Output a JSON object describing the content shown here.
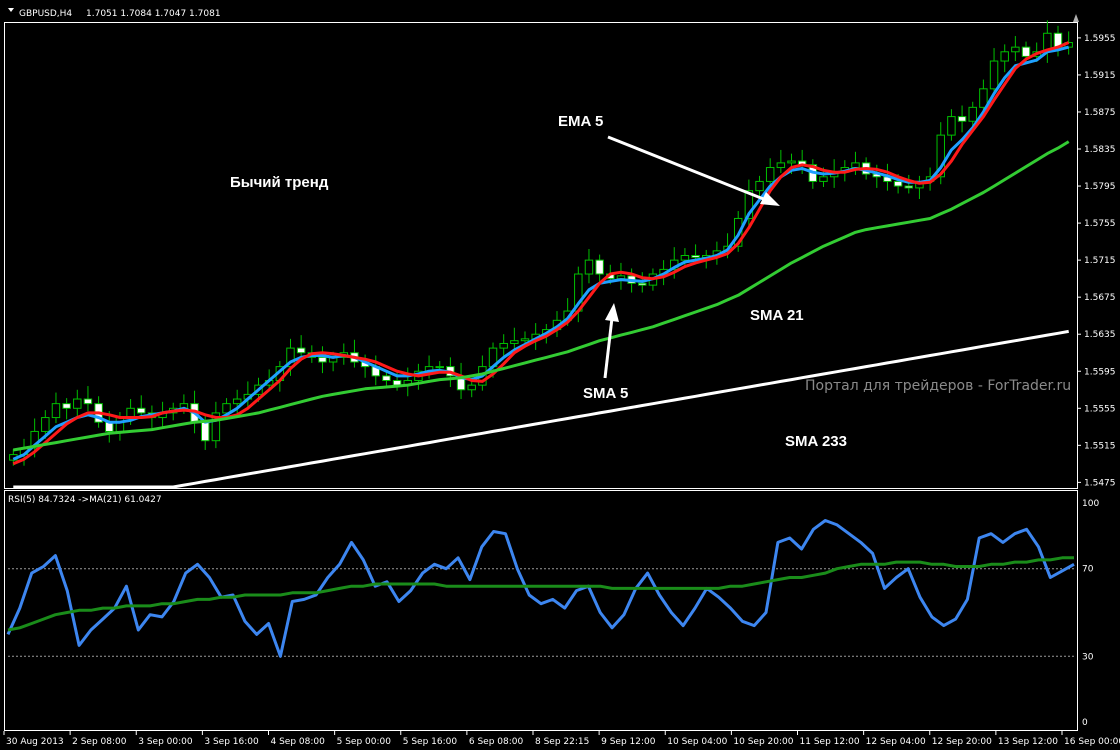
{
  "header": {
    "symbol": "GBPUSD,H4",
    "ohlc": "1.7051 1.7084 1.7047 1.7081"
  },
  "rsi_header": "RSI(5) 84.7324 ->MA(21) 61.0427",
  "annotations": {
    "trend": "Бычий тренд",
    "ema5": "EMA 5",
    "sma5": "SMA 5",
    "sma21": "SMA 21",
    "sma233": "SMA 233",
    "watermark": "Портал для трейдеров - ForTrader.ru"
  },
  "colors": {
    "background": "#000000",
    "frame": "#ffffff",
    "bull_candle": "#00c000",
    "bear_candle_body": "#ffffff",
    "ema5": "#1fa0ff",
    "sma5": "#ff1a1a",
    "sma21": "#33cc33",
    "sma233": "#ffffff",
    "rsi": "#3d86f0",
    "rsi_ma": "#1a8c1a",
    "fractal": "#b0b0b0"
  },
  "chart_data": [
    {
      "type": "candlestick",
      "title": "GBPUSD,H4",
      "price_ticks": [
        "1.5955",
        "1.5915",
        "1.5875",
        "1.5835",
        "1.5795",
        "1.5755",
        "1.5715",
        "1.5675",
        "1.5635",
        "1.5595",
        "1.5555",
        "1.5515",
        "1.5475"
      ],
      "ylim": [
        1.547,
        1.597
      ],
      "time_ticks": [
        "30 Aug 2013",
        "2 Sep 08:00",
        "3 Sep 00:00",
        "3 Sep 16:00",
        "4 Sep 08:00",
        "5 Sep 00:00",
        "5 Sep 16:00",
        "6 Sep 08:00",
        "8 Sep 22:15",
        "9 Sep 12:00",
        "10 Sep 04:00",
        "10 Sep 20:00",
        "11 Sep 12:00",
        "12 Sep 04:00",
        "12 Sep 20:00",
        "13 Sep 12:00",
        "16 Sep 00:00"
      ],
      "closes": [
        1.5505,
        1.5512,
        1.553,
        1.5545,
        1.556,
        1.5555,
        1.5565,
        1.556,
        1.554,
        1.553,
        1.5545,
        1.5555,
        1.555,
        1.5545,
        1.555,
        1.5555,
        1.556,
        1.554,
        1.552,
        1.555,
        1.556,
        1.5565,
        1.557,
        1.558,
        1.5585,
        1.56,
        1.562,
        1.5615,
        1.561,
        1.5605,
        1.561,
        1.5615,
        1.5605,
        1.56,
        1.559,
        1.5585,
        1.558,
        1.5585,
        1.5595,
        1.56,
        1.56,
        1.559,
        1.5575,
        1.558,
        1.56,
        1.562,
        1.5625,
        1.5628,
        1.563,
        1.5635,
        1.564,
        1.565,
        1.566,
        1.57,
        1.5715,
        1.57,
        1.5695,
        1.5698,
        1.569,
        1.5688,
        1.57,
        1.5705,
        1.5715,
        1.572,
        1.5718,
        1.572,
        1.5725,
        1.573,
        1.576,
        1.579,
        1.58,
        1.5815,
        1.582,
        1.5822,
        1.5818,
        1.58,
        1.5805,
        1.581,
        1.5815,
        1.582,
        1.5808,
        1.5805,
        1.58,
        1.5795,
        1.5793,
        1.58,
        1.5805,
        1.585,
        1.587,
        1.5865,
        1.588,
        1.59,
        1.593,
        1.594,
        1.5945,
        1.5935,
        1.594,
        1.596,
        1.5945,
        1.595
      ],
      "series": [
        {
          "name": "EMA 5",
          "values": [
            1.55,
            1.5505,
            1.5515,
            1.5525,
            1.5535,
            1.554,
            1.5545,
            1.5548,
            1.5545,
            1.554,
            1.554,
            1.5542,
            1.5546,
            1.5548,
            1.555,
            1.5552,
            1.5555,
            1.555,
            1.554,
            1.5542,
            1.5548,
            1.5555,
            1.5565,
            1.5575,
            1.5585,
            1.5595,
            1.5605,
            1.561,
            1.5612,
            1.5612,
            1.561,
            1.5612,
            1.561,
            1.5605,
            1.56,
            1.5595,
            1.559,
            1.559,
            1.5592,
            1.5595,
            1.5596,
            1.5594,
            1.5588,
            1.5586,
            1.559,
            1.56,
            1.561,
            1.5618,
            1.5624,
            1.563,
            1.5636,
            1.5643,
            1.5652,
            1.5668,
            1.5683,
            1.569,
            1.5692,
            1.5694,
            1.5693,
            1.5692,
            1.5695,
            1.57,
            1.5707,
            1.5713,
            1.5715,
            1.5717,
            1.572,
            1.5726,
            1.5742,
            1.5765,
            1.578,
            1.5795,
            1.5805,
            1.5812,
            1.5814,
            1.581,
            1.5808,
            1.5809,
            1.5811,
            1.5814,
            1.5812,
            1.5809,
            1.5806,
            1.5802,
            1.5799,
            1.5799,
            1.5801,
            1.5815,
            1.5834,
            1.5845,
            1.5858,
            1.5875,
            1.5895,
            1.5912,
            1.5925,
            1.5928,
            1.5931,
            1.594,
            1.5942,
            1.5945
          ]
        },
        {
          "name": "SMA 5",
          "values": [
            1.5495,
            1.55,
            1.5508,
            1.5518,
            1.5528,
            1.5538,
            1.5545,
            1.555,
            1.555,
            1.5548,
            1.5545,
            1.5545,
            1.5545,
            1.5546,
            1.555,
            1.5552,
            1.5553,
            1.5552,
            1.5548,
            1.5545,
            1.5545,
            1.5548,
            1.5555,
            1.5565,
            1.5575,
            1.5585,
            1.5598,
            1.5608,
            1.5614,
            1.5615,
            1.5614,
            1.5612,
            1.561,
            1.5608,
            1.5605,
            1.56,
            1.5595,
            1.5592,
            1.559,
            1.5592,
            1.5594,
            1.5594,
            1.559,
            1.5585,
            1.5584,
            1.5592,
            1.5603,
            1.5615,
            1.5622,
            1.5628,
            1.5633,
            1.564,
            1.5648,
            1.566,
            1.5675,
            1.569,
            1.57,
            1.5702,
            1.57,
            1.5696,
            1.5695,
            1.5697,
            1.5702,
            1.5708,
            1.5712,
            1.5715,
            1.5718,
            1.5722,
            1.5733,
            1.575,
            1.577,
            1.579,
            1.5805,
            1.5815,
            1.5818,
            1.5816,
            1.5812,
            1.581,
            1.581,
            1.5813,
            1.5814,
            1.5813,
            1.581,
            1.5805,
            1.5801,
            1.5798,
            1.5799,
            1.5808,
            1.5822,
            1.584,
            1.5855,
            1.587,
            1.5888,
            1.5905,
            1.5922,
            1.5932,
            1.5938,
            1.5942,
            1.5945,
            1.595
          ]
        },
        {
          "name": "SMA 21",
          "values": [
            1.551,
            1.5512,
            1.5514,
            1.5516,
            1.5518,
            1.552,
            1.5522,
            1.5524,
            1.5526,
            1.5528,
            1.5529,
            1.553,
            1.5531,
            1.5532,
            1.5534,
            1.5536,
            1.5538,
            1.554,
            1.5541,
            1.5542,
            1.5544,
            1.5546,
            1.5548,
            1.555,
            1.5553,
            1.5556,
            1.5559,
            1.5562,
            1.5565,
            1.5568,
            1.557,
            1.5572,
            1.5574,
            1.5576,
            1.5577,
            1.5578,
            1.5579,
            1.558,
            1.5582,
            1.5584,
            1.5586,
            1.5587,
            1.5588,
            1.559,
            1.5592,
            1.5595,
            1.5598,
            1.5601,
            1.5604,
            1.5607,
            1.561,
            1.5613,
            1.5616,
            1.562,
            1.5624,
            1.5628,
            1.5631,
            1.5634,
            1.5637,
            1.564,
            1.5643,
            1.5647,
            1.5651,
            1.5655,
            1.5659,
            1.5663,
            1.5667,
            1.5672,
            1.5677,
            1.5684,
            1.5691,
            1.5698,
            1.5705,
            1.5712,
            1.5718,
            1.5724,
            1.573,
            1.5735,
            1.574,
            1.5745,
            1.5748,
            1.575,
            1.5752,
            1.5754,
            1.5756,
            1.5758,
            1.576,
            1.5765,
            1.577,
            1.5776,
            1.5782,
            1.5788,
            1.5795,
            1.5802,
            1.5809,
            1.5816,
            1.5823,
            1.583,
            1.5836,
            1.5843
          ]
        },
        {
          "name": "SMA 233",
          "values": [
            1.544,
            1.5442,
            1.5444,
            1.5446,
            1.5448,
            1.545,
            1.5452,
            1.5454,
            1.5456,
            1.5458,
            1.546,
            1.5462,
            1.5464,
            1.5466,
            1.5468,
            1.547,
            1.5472,
            1.5474,
            1.5476,
            1.5478,
            1.548,
            1.5482,
            1.5484,
            1.5486,
            1.5488,
            1.549,
            1.5492,
            1.5494,
            1.5496,
            1.5498,
            1.55,
            1.5502,
            1.5504,
            1.5506,
            1.5508,
            1.551,
            1.5512,
            1.5514,
            1.5516,
            1.5518,
            1.552,
            1.5522,
            1.5524,
            1.5526,
            1.5528,
            1.553,
            1.5532,
            1.5534,
            1.5536,
            1.5538,
            1.554,
            1.5542,
            1.5544,
            1.5546,
            1.5548,
            1.555,
            1.5552,
            1.5554,
            1.5556,
            1.5558,
            1.556,
            1.5562,
            1.5564,
            1.5566,
            1.5568,
            1.557,
            1.5572,
            1.5574,
            1.5576,
            1.5578,
            1.558,
            1.5582,
            1.5584,
            1.5586,
            1.5588,
            1.559,
            1.5592,
            1.5594,
            1.5596,
            1.5598,
            1.56,
            1.5602,
            1.5604,
            1.5606,
            1.5608,
            1.561,
            1.5612,
            1.5614,
            1.5616,
            1.5618,
            1.562,
            1.5622,
            1.5624,
            1.5626,
            1.5628,
            1.563,
            1.5632,
            1.5634,
            1.5636,
            1.5638
          ]
        }
      ]
    },
    {
      "type": "line",
      "title": "RSI(5) 84.7324 ->MA(21) 61.0427",
      "ylim": [
        0,
        100
      ],
      "y_ticks": [
        "100",
        "70",
        "30",
        "0"
      ],
      "levels": [
        70,
        30
      ],
      "series": [
        {
          "name": "RSI(5)",
          "values": [
            40,
            52,
            68,
            71,
            76,
            60,
            35,
            42,
            47,
            52,
            62,
            42,
            49,
            48,
            55,
            68,
            72,
            66,
            57,
            58,
            46,
            40,
            45,
            30,
            55,
            56,
            58,
            66,
            72,
            82,
            74,
            62,
            64,
            55,
            60,
            68,
            72,
            70,
            75,
            65,
            80,
            87,
            86,
            70,
            58,
            54,
            56,
            52,
            60,
            62,
            50,
            43,
            49,
            61,
            68,
            58,
            50,
            44,
            52,
            61,
            57,
            52,
            46,
            44,
            50,
            82,
            84,
            79,
            88,
            92,
            90,
            86,
            82,
            77,
            61,
            66,
            70,
            57,
            48,
            44,
            47,
            56,
            84,
            86,
            82,
            86,
            88,
            80,
            66,
            69,
            72
          ]
        },
        {
          "name": "MA(21)",
          "values": [
            42,
            43,
            45,
            47,
            49,
            50,
            51,
            51,
            52,
            52,
            53,
            53,
            53,
            54,
            54,
            55,
            56,
            56,
            57,
            57,
            58,
            58,
            58,
            58,
            59,
            59,
            59,
            60,
            61,
            62,
            62,
            63,
            63,
            63,
            63,
            63,
            63,
            62,
            62,
            62,
            62,
            62,
            62,
            62,
            62,
            62,
            62,
            62,
            62,
            62,
            62,
            61,
            61,
            61,
            61,
            61,
            61,
            61,
            61,
            61,
            61,
            62,
            62,
            63,
            64,
            65,
            66,
            66,
            67,
            68,
            70,
            71,
            72,
            72,
            72,
            73,
            73,
            73,
            72,
            72,
            71,
            71,
            71,
            72,
            72,
            73,
            73,
            74,
            74,
            75,
            75
          ]
        }
      ]
    }
  ]
}
